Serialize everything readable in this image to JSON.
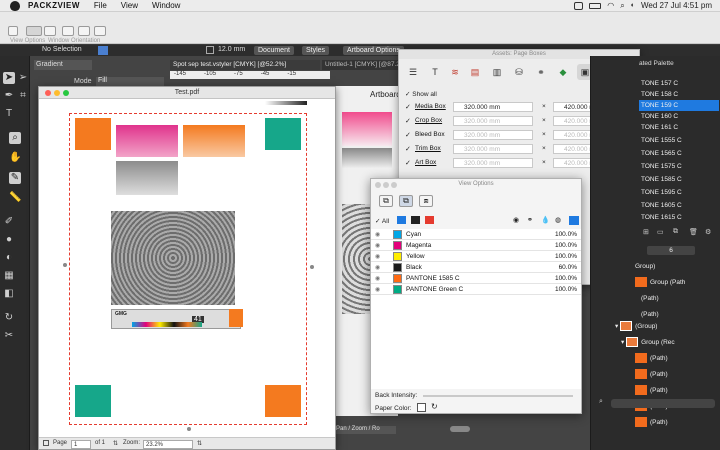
{
  "menubar": {
    "app": "PACKZVIEW",
    "items": [
      "File",
      "View",
      "Window"
    ],
    "datetime": "Wed 27 Jul  4:51 pm"
  },
  "toolbar": {
    "label_view_options": "View Options",
    "label_window_orientation": "Window Orientation"
  },
  "ctxbar": {
    "selection": "No Selection",
    "stroke": "12.0 mm",
    "document": "Document",
    "styles": "Styles",
    "artboard_options": "Artboard Options",
    "gradient": "Gradient",
    "mode_label": "Mode",
    "mode_value": "Fill",
    "tab1": "Spot sep test.vstyler [CMYK] [@52.2%]",
    "tab2": "Untitled-1 [CMYK] [@87.2%]",
    "ruler": [
      "-145",
      "-105",
      "-75",
      "-45",
      "-15"
    ],
    "artboard": "Artboard",
    "palette": "ated Palette"
  },
  "pdf": {
    "title": "Test.pdf",
    "page_label": "Page",
    "page_value": "1",
    "of_label": "of 1",
    "zoom_label": "Zoom:",
    "zoom_value": "23.2%",
    "strip_text": "GMG",
    "strip_code": "41",
    "swatch_colors": {
      "orange": "#f47a1f",
      "magenta": "#e0338c",
      "green": "#16a78a",
      "grey": "#8c8c8c"
    }
  },
  "assets": {
    "title": "Assets: Page Boxes",
    "show_all": "Show all",
    "boxes": [
      {
        "name": "Media Box",
        "w": "320.000 mm",
        "h": "420.000 mm",
        "enabled": true
      },
      {
        "name": "Crop Box",
        "w": "320.000 mm",
        "h": "420.000 mm",
        "enabled": false
      },
      {
        "name": "Bleed Box",
        "w": "320.000 mm",
        "h": "420.000 mm",
        "enabled": false
      },
      {
        "name": "Trim Box",
        "w": "320.000 mm",
        "h": "420.000 mm",
        "enabled": false
      },
      {
        "name": "Art Box",
        "w": "320.000 mm",
        "h": "420.000 mm",
        "enabled": false
      }
    ],
    "times": "×"
  },
  "viewopts": {
    "title": "View Options",
    "all": "All",
    "channels": [
      {
        "name": "Cyan",
        "percent": "100.0%",
        "color": "#00a6e6"
      },
      {
        "name": "Magenta",
        "percent": "100.0%",
        "color": "#e3007b"
      },
      {
        "name": "Yellow",
        "percent": "100.0%",
        "color": "#ffed00"
      },
      {
        "name": "Black",
        "percent": "60.0%",
        "color": "#1a1a1a"
      },
      {
        "name": "PANTONE 1585 C",
        "percent": "100.0%",
        "color": "#ff6a13"
      },
      {
        "name": "PANTONE Green C",
        "percent": "100.0%",
        "color": "#00ab84"
      }
    ],
    "back_intensity": "Back Intensity:",
    "paper_color": "Paper Color:"
  },
  "rpanel": {
    "swatches": [
      "TONE 157 C",
      "TONE 158 C",
      "TONE 159 C",
      "TONE 160 C",
      "TONE 161 C",
      "TONE 1555 C",
      "TONE 1565 C",
      "TONE 1575 C",
      "TONE 1585 C",
      "TONE 1595 C",
      "TONE 1605 C",
      "TONE 1615 C"
    ],
    "layers": [
      "Group)",
      "Group (Path",
      "(Path)",
      "(Path)",
      "(Group)",
      "Group (Rec",
      "(Path)",
      "(Path)",
      "(Path)",
      "(Path)",
      "(Path)"
    ],
    "stepper_value": "6"
  },
  "bottom": {
    "pan_zoom": "Pan / Zoom / Ro"
  }
}
